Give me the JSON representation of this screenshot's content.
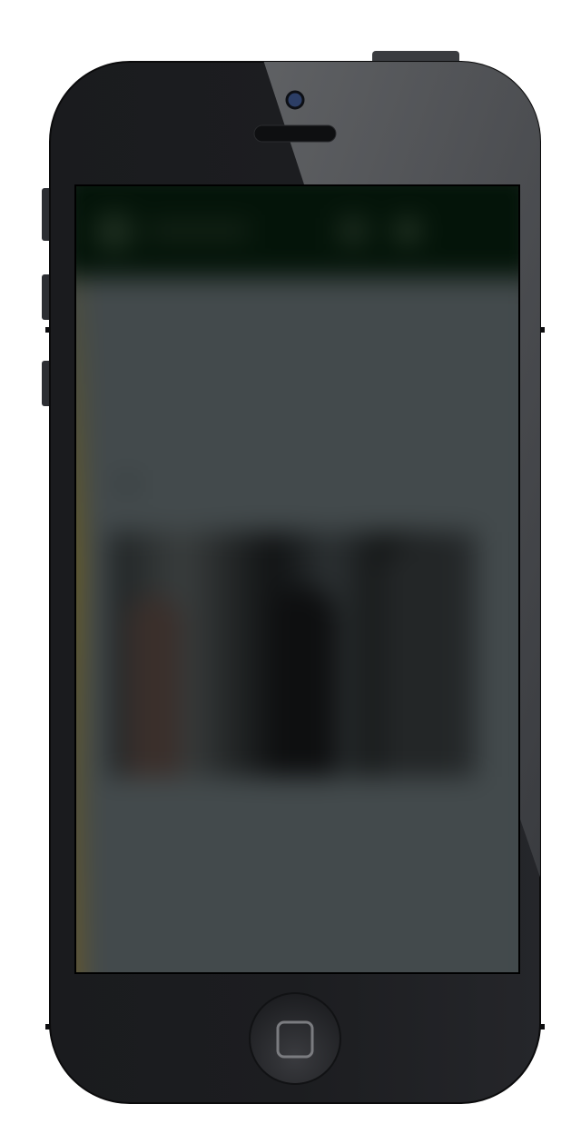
{
  "device": {
    "model": "iPhone 5",
    "body_color": "#1b1c1f",
    "bezel_highlight_color": "#5e6063",
    "camera_color": "#2c3e66",
    "button_color": "#2c2e33"
  },
  "screen": {
    "blurred": true,
    "header_color": "#041409",
    "background_color": "#434a4c",
    "accent_bar_color": "#6b5d22"
  },
  "article": {
    "title": "",
    "subtitle": "",
    "caption": ""
  },
  "icons": {
    "logo": "site-logo-icon",
    "search": "search-icon",
    "account": "user-icon",
    "home": "home-square-icon"
  }
}
